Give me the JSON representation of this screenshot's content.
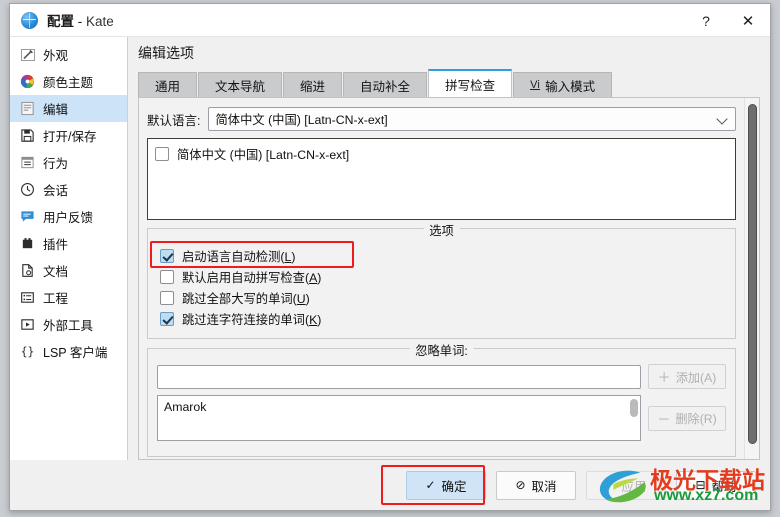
{
  "window": {
    "title_main": "配置",
    "title_sep": " - ",
    "title_app": "Kate",
    "help_btn": "?",
    "close_btn": "✕"
  },
  "sidebar": {
    "items": [
      {
        "label": "外观",
        "icon": "appearance-pen-icon",
        "selected": false
      },
      {
        "label": "颜色主题",
        "icon": "color-wheel-icon",
        "selected": false
      },
      {
        "label": "编辑",
        "icon": "edit-document-icon",
        "selected": true
      },
      {
        "label": "打开/保存",
        "icon": "floppy-save-icon",
        "selected": false
      },
      {
        "label": "行为",
        "icon": "behavior-lines-icon",
        "selected": false
      },
      {
        "label": "会话",
        "icon": "clock-session-icon",
        "selected": false
      },
      {
        "label": "用户反馈",
        "icon": "feedback-bubble-icon",
        "selected": false
      },
      {
        "label": "插件",
        "icon": "plugin-box-icon",
        "selected": false
      },
      {
        "label": "文档",
        "icon": "document-icon",
        "selected": false
      },
      {
        "label": "工程",
        "icon": "project-list-icon",
        "selected": false
      },
      {
        "label": "外部工具",
        "icon": "external-tool-play-icon",
        "selected": false
      },
      {
        "label": "LSP 客户端",
        "icon": "braces-icon",
        "selected": false
      }
    ]
  },
  "pane": {
    "title": "编辑选项",
    "tabs": [
      {
        "label": "通用",
        "active": false,
        "prefix": ""
      },
      {
        "label": "文本导航",
        "active": false,
        "prefix": ""
      },
      {
        "label": "缩进",
        "active": false,
        "prefix": ""
      },
      {
        "label": "自动补全",
        "active": false,
        "prefix": ""
      },
      {
        "label": "拼写检查",
        "active": true,
        "prefix": ""
      },
      {
        "label": "输入模式",
        "active": false,
        "prefix": "Vi"
      }
    ]
  },
  "spellcheck": {
    "language_label": "默认语言:",
    "language_value": "简体中文 (中国) [Latn-CN-x-ext]",
    "language_list": [
      {
        "label": "简体中文 (中国) [Latn-CN-x-ext]",
        "checked": false
      }
    ],
    "options_group_title": "选项",
    "options": [
      {
        "label": "启动语言自动检测(",
        "mnemonic": "L",
        "suffix": ")",
        "checked": true,
        "highlighted": true
      },
      {
        "label": "默认启用自动拼写检查(",
        "mnemonic": "A",
        "suffix": ")",
        "checked": false,
        "highlighted": false
      },
      {
        "label": "跳过全部大写的单词(",
        "mnemonic": "U",
        "suffix": ")",
        "checked": false,
        "highlighted": false
      },
      {
        "label": "跳过连字符连接的单词(",
        "mnemonic": "K",
        "suffix": ")",
        "checked": true,
        "highlighted": false
      }
    ],
    "ignore_group_title": "忽略单词:",
    "ignore_input_value": "",
    "add_button": {
      "sign": "＋",
      "label": "添加(A)"
    },
    "remove_button": {
      "sign": "－",
      "label": "删除(R)"
    },
    "ignored_words": [
      "Amarok"
    ]
  },
  "footer": {
    "ok": {
      "icon": "✓",
      "label": "确定",
      "primary": true,
      "highlighted": true
    },
    "cancel": {
      "icon": "⊘",
      "label": "取消"
    },
    "apply": {
      "icon": "✓",
      "label": "应用",
      "disabled": true
    },
    "help": {
      "icon": "⊟",
      "label": "帮助"
    }
  },
  "watermark": {
    "text": "极光下载站",
    "url": "www.xz7.com"
  },
  "colors": {
    "accent": "#2e9ee0",
    "selection": "#cde3f7",
    "highlight": "#ee1c1c",
    "primary_button": "#cfe5f7"
  }
}
